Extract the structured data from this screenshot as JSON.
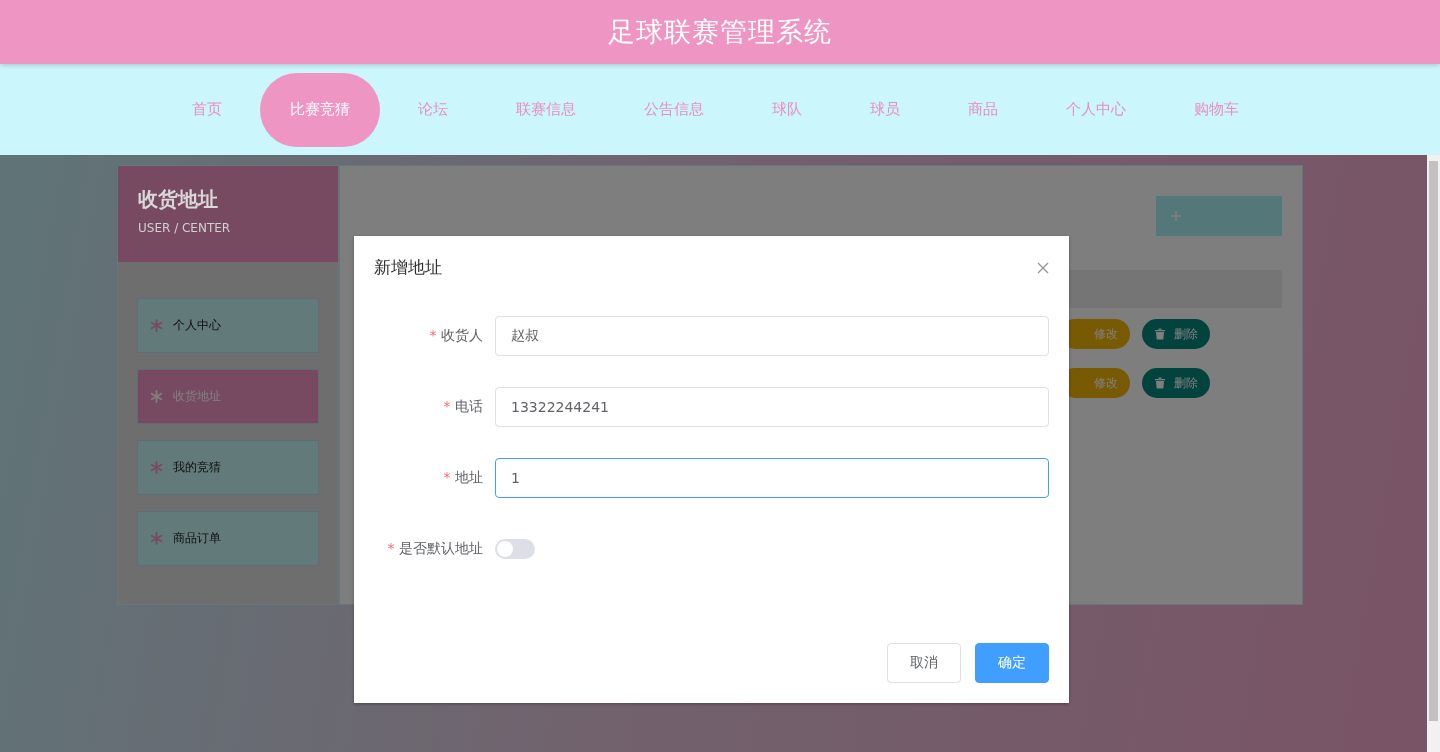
{
  "header": {
    "title": "足球联赛管理系统"
  },
  "nav": [
    {
      "label": "首页",
      "selected": false
    },
    {
      "label": "比赛竞猜",
      "selected": true
    },
    {
      "label": "论坛",
      "selected": false
    },
    {
      "label": "联赛信息",
      "selected": false
    },
    {
      "label": "公告信息",
      "selected": false
    },
    {
      "label": "球队",
      "selected": false
    },
    {
      "label": "球员",
      "selected": false
    },
    {
      "label": "商品",
      "selected": false
    },
    {
      "label": "个人中心",
      "selected": false
    },
    {
      "label": "购物车",
      "selected": false
    }
  ],
  "sidebar": {
    "title": "收货地址",
    "subtitle": "USER / CENTER",
    "items": [
      {
        "label": "个人中心",
        "selected": false
      },
      {
        "label": "收货地址",
        "selected": true
      },
      {
        "label": "我的竞猜",
        "selected": false
      },
      {
        "label": "商品订单",
        "selected": false
      }
    ]
  },
  "main": {
    "rows": [
      {
        "edit": "修改",
        "delete": "删除"
      },
      {
        "edit": "修改",
        "delete": "删除"
      }
    ]
  },
  "dialog": {
    "title": "新增地址",
    "fields": [
      {
        "kind": "text",
        "mark": "*",
        "label": "收货人",
        "value": "赵叔",
        "focused": false
      },
      {
        "kind": "text",
        "mark": "*",
        "label": "电话",
        "value": "13322244241",
        "focused": false
      },
      {
        "kind": "text",
        "mark": "*",
        "label": "地址",
        "value": "1",
        "focused": true
      },
      {
        "kind": "switch",
        "mark": "*",
        "label": "是否默认地址",
        "on": false
      }
    ],
    "buttons": [
      {
        "label": "取消",
        "kind": "default"
      },
      {
        "label": "确定",
        "kind": "primary"
      }
    ]
  }
}
